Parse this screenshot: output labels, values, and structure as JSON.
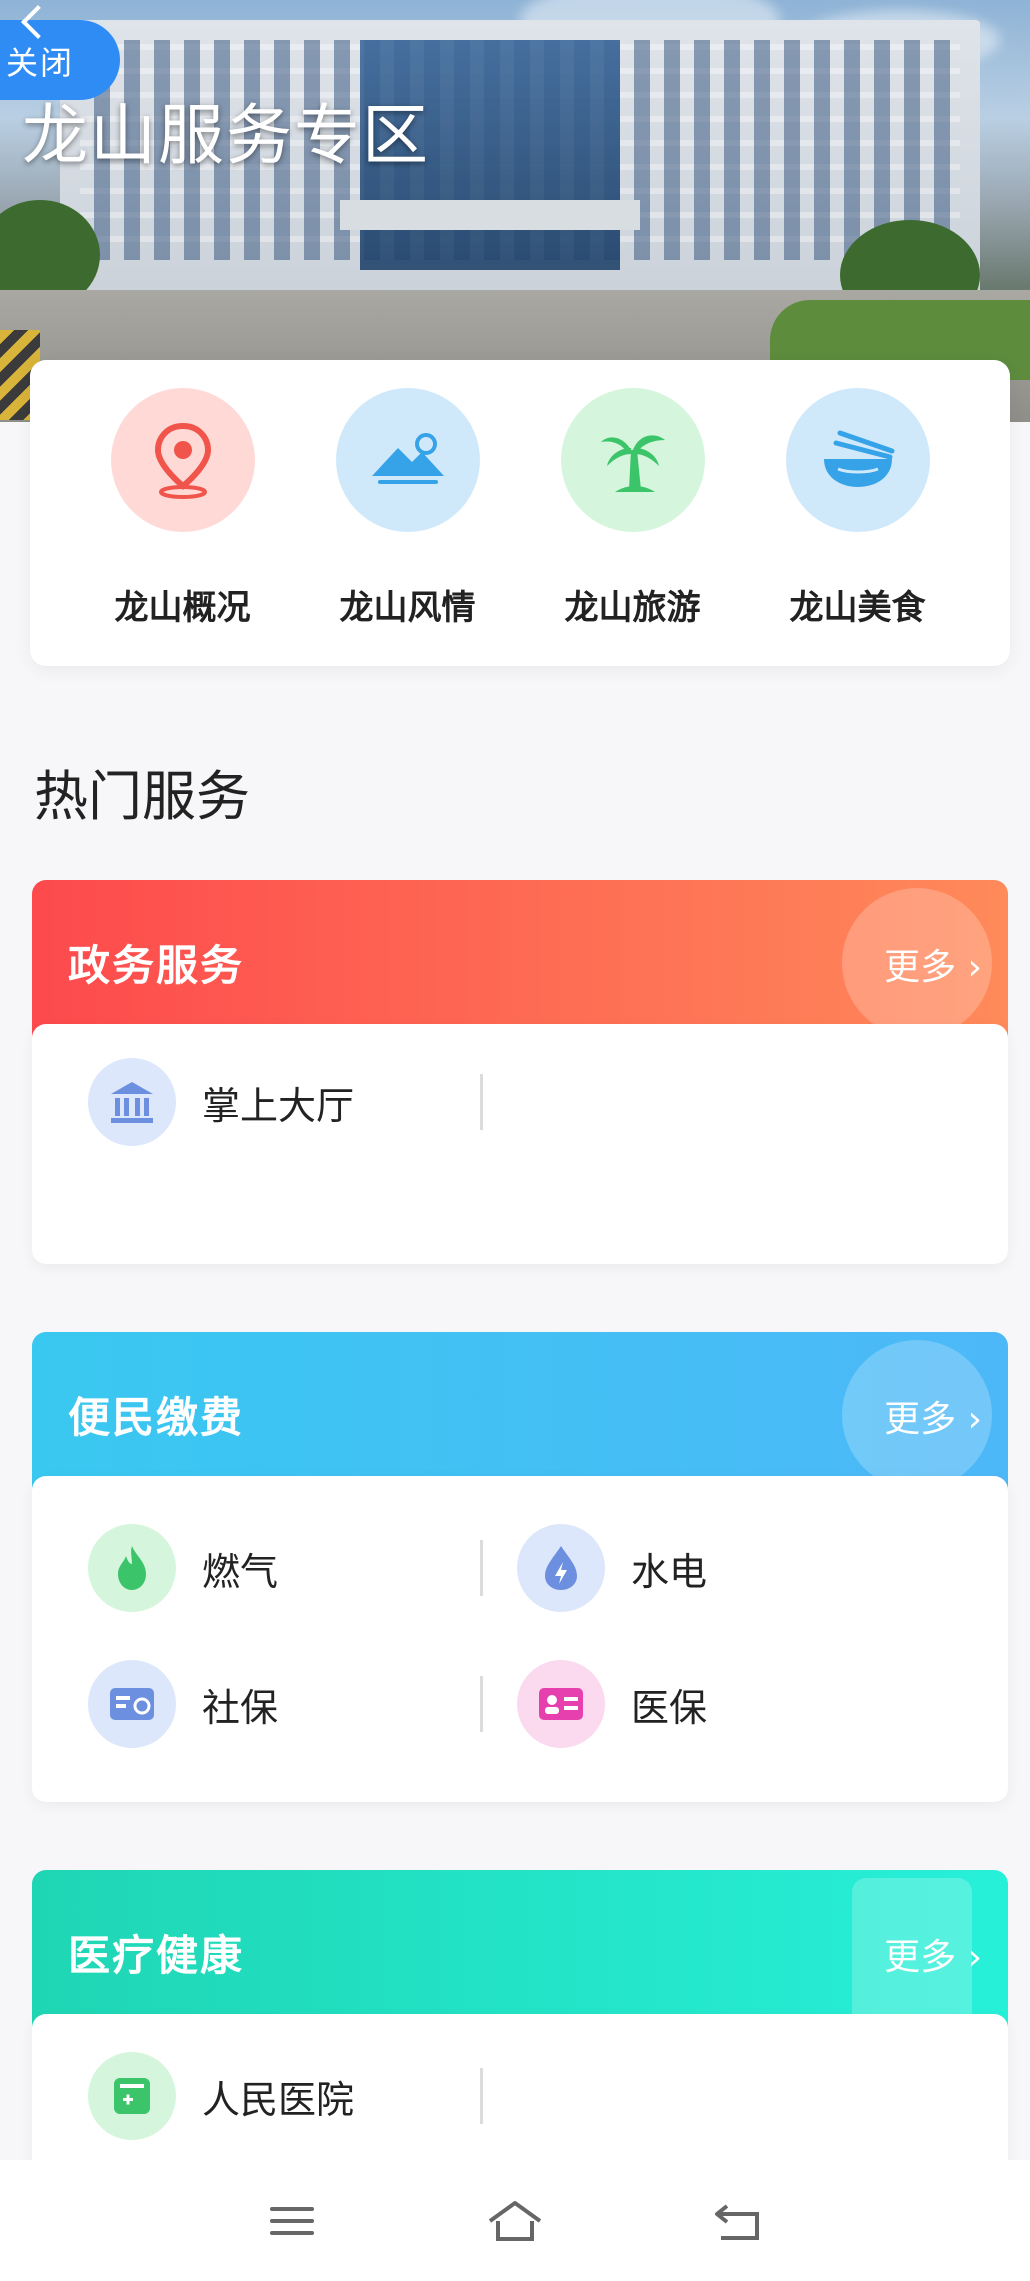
{
  "hero": {
    "close_label": "关闭",
    "title": "龙山服务专区"
  },
  "categories": [
    {
      "label": "龙山概况",
      "icon": "location-pin-icon",
      "bg": "#ffd9d6",
      "color": "#f0544a"
    },
    {
      "label": "龙山风情",
      "icon": "mountain-icon",
      "bg": "#cfe9fb",
      "color": "#36a3e8"
    },
    {
      "label": "龙山旅游",
      "icon": "palm-tree-icon",
      "bg": "#d5f6dc",
      "color": "#3cc46b"
    },
    {
      "label": "龙山美食",
      "icon": "noodle-bowl-icon",
      "bg": "#cfe9fb",
      "color": "#36a3e8"
    }
  ],
  "hot_services_title": "热门服务",
  "sections": {
    "gov": {
      "title": "政务服务",
      "more": "更多",
      "items": [
        {
          "label": "掌上大厅",
          "icon": "government-building-icon"
        }
      ]
    },
    "pay": {
      "title": "便民缴费",
      "more": "更多",
      "items": [
        {
          "label": "燃气",
          "icon": "flame-icon"
        },
        {
          "label": "水电",
          "icon": "water-drop-icon"
        },
        {
          "label": "社保",
          "icon": "social-card-icon"
        },
        {
          "label": "医保",
          "icon": "medical-card-icon"
        }
      ]
    },
    "health": {
      "title": "医疗健康",
      "more": "更多",
      "items": [
        {
          "label": "人民医院",
          "icon": "hospital-icon"
        }
      ]
    }
  },
  "colors": {
    "gov_gradient": [
      "#fd4a4d",
      "#ff8a5a"
    ],
    "pay_gradient": [
      "#39c8f0",
      "#4db8f8"
    ],
    "health_gradient": [
      "#1fd6b4",
      "#27f0d9"
    ]
  }
}
